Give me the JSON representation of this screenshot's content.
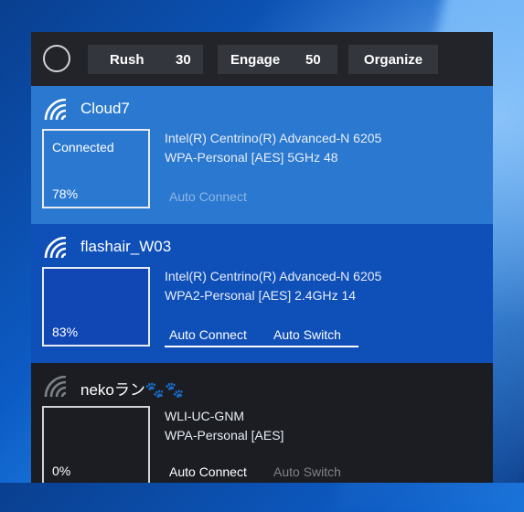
{
  "toolbar": {
    "rush_label": "Rush",
    "rush_value": "30",
    "engage_label": "Engage",
    "engage_value": "50",
    "organize_label": "Organize"
  },
  "networks": [
    {
      "ssid": "Cloud7",
      "state": "Connected",
      "signal": "78%",
      "adapter": "Intel(R) Centrino(R) Advanced-N 6205",
      "security": "WPA-Personal [AES] 5GHz 48",
      "auto_connect": "Auto Connect"
    },
    {
      "ssid": "flashair_W03",
      "signal": "83%",
      "adapter": "Intel(R) Centrino(R) Advanced-N 6205",
      "security": "WPA2-Personal [AES] 2.4GHz 14",
      "auto_connect": "Auto Connect",
      "auto_switch": "Auto Switch"
    },
    {
      "ssid": "nekoラン🐾🐾",
      "signal": "0%",
      "adapter": "WLI-UC-GNM",
      "security": "WPA-Personal [AES]",
      "auto_connect": "Auto Connect",
      "auto_switch": "Auto Switch"
    }
  ],
  "colors": {
    "panel_bg": "#1b1d22",
    "connected_bg": "#2a78cf",
    "selected_bg": "#0e4fb8",
    "button_bg": "#33363c"
  }
}
